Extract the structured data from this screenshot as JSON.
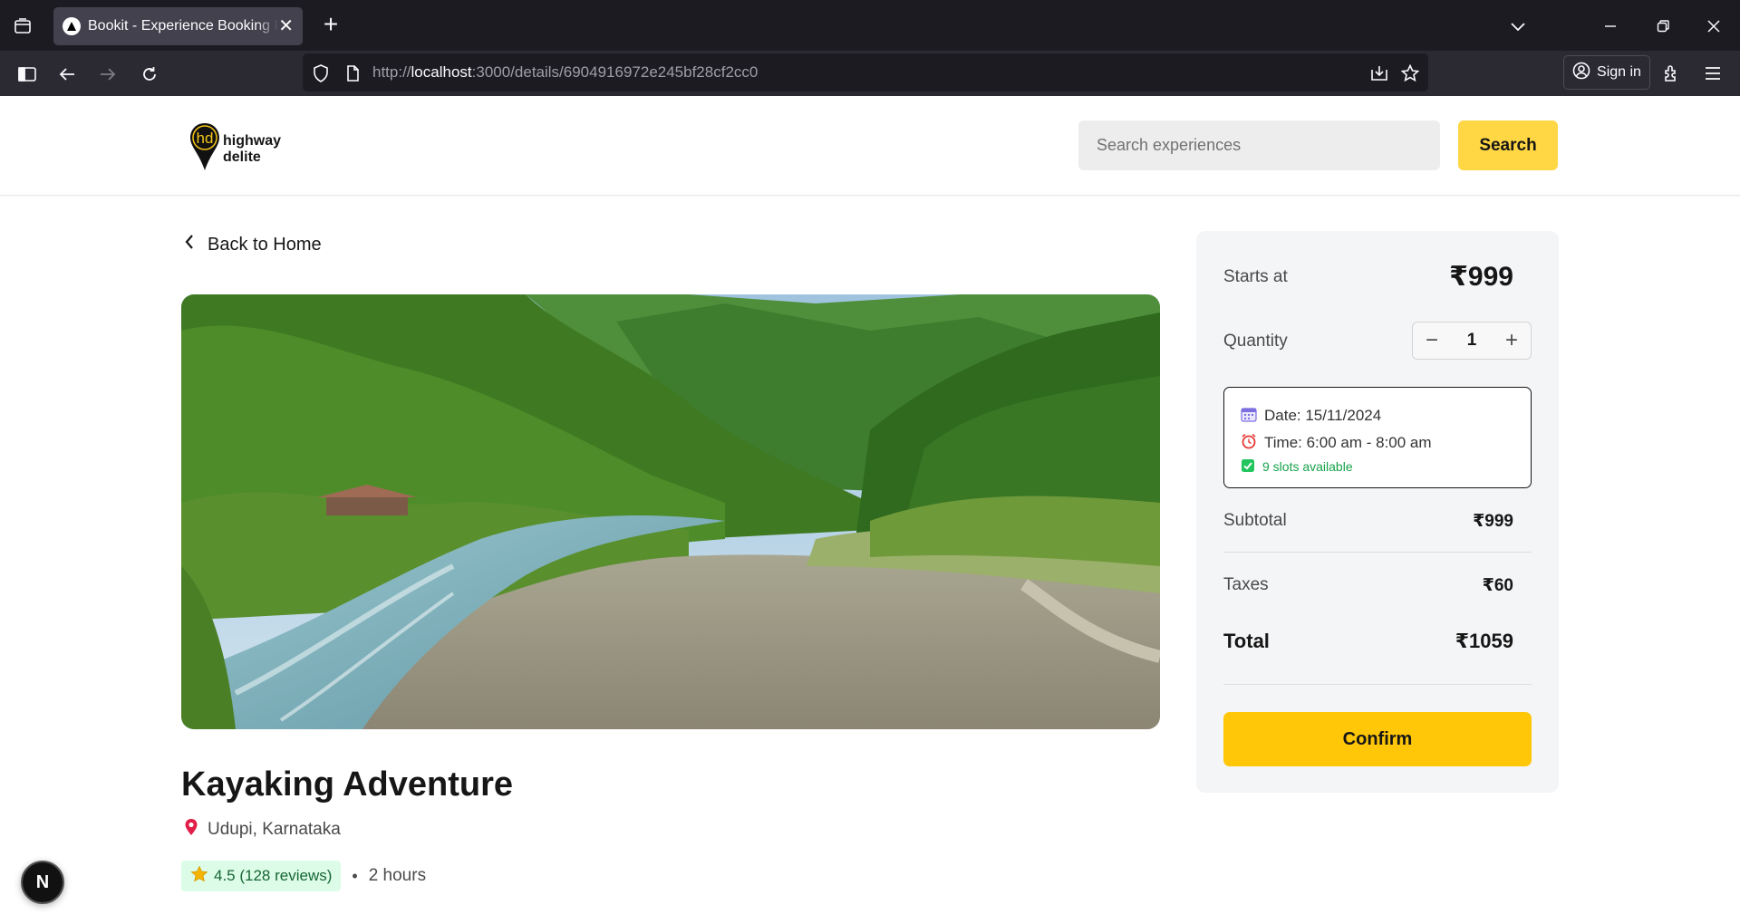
{
  "browser": {
    "tab_title": "Bookit - Experience Booking Platform",
    "tab_close": "✕",
    "new_tab": "+",
    "url_prefix": "http://",
    "url_host": "localhost",
    "url_path": ":3000/details/6904916972e245bf28cf2cc0",
    "sign_in": "Sign in"
  },
  "header": {
    "logo_line1": "highway",
    "logo_line2": "delite",
    "logo_mark": "hd",
    "search_placeholder": "Search experiences",
    "search_label": "Search"
  },
  "main": {
    "back_label": "Back to Home",
    "title": "Kayaking Adventure",
    "location": "Udupi, Karnataka",
    "rating": "4.5 (128 reviews)",
    "separator": "•",
    "duration": "2 hours"
  },
  "booking": {
    "starts_at_label": "Starts at",
    "starts_at_price": "₹999",
    "quantity_label": "Quantity",
    "minus": "−",
    "plus": "+",
    "quantity": "1",
    "date": "Date: 15/11/2024",
    "time": "Time: 6:00 am - 8:00 am",
    "slots": "9 slots available",
    "subtotal_label": "Subtotal",
    "subtotal": "₹999",
    "taxes_label": "Taxes",
    "taxes": "₹60",
    "total_label": "Total",
    "total": "₹1059",
    "confirm_label": "Confirm"
  },
  "dev_badge": "N",
  "colors": {
    "accent": "#ffc708",
    "search_button": "#ffd643",
    "rating_bg": "#dcfce7",
    "slots_green": "#16a34a"
  }
}
